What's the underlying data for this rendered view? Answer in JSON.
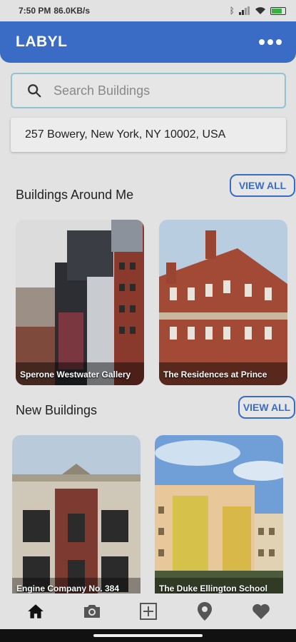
{
  "status_bar": {
    "time": "7:50 PM",
    "network": "86.0KB/s",
    "icons": [
      "bluetooth-icon",
      "signal-icon",
      "wifi-icon",
      "battery-icon"
    ]
  },
  "header": {
    "title": "LABYL",
    "menu_icon": "more-dots-icon"
  },
  "search": {
    "placeholder": "Search Buildings",
    "icon": "search-icon"
  },
  "address": "257 Bowery, New York, NY 10002, USA",
  "sections": {
    "around": {
      "title": "Buildings Around Me",
      "view_all": "VIEW ALL",
      "cards": [
        {
          "label": "Sperone Westwater Gallery"
        },
        {
          "label": "The Residences at Prince"
        }
      ]
    },
    "new": {
      "title": "New Buildings",
      "view_all": "VIEW ALL",
      "cards": [
        {
          "label": "Engine Company No. 384"
        },
        {
          "label": "The Duke Ellington School"
        }
      ]
    }
  },
  "bottom_nav": [
    "home-icon",
    "camera-icon",
    "add-icon",
    "location-pin-icon",
    "heart-icon"
  ],
  "colors": {
    "accent": "#3a6cc6",
    "background": "#e2e2e2"
  }
}
